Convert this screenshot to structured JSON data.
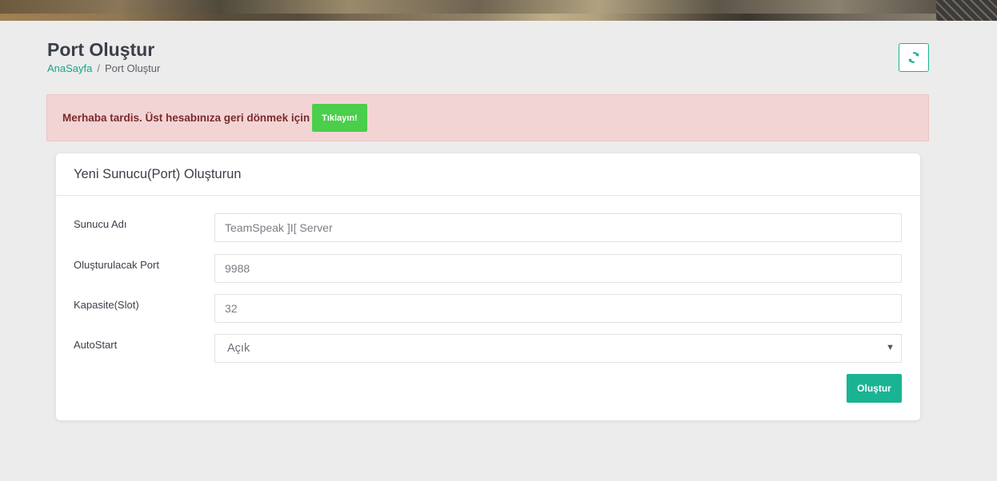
{
  "page": {
    "title": "Port Oluştur",
    "breadcrumb": {
      "home": "AnaSayfa",
      "separator": "/",
      "current": "Port Oluştur"
    }
  },
  "refresh": {
    "icon": "refresh-icon"
  },
  "alert": {
    "message": "Merhaba tardis. Üst hesabınıza geri dönmek için",
    "button_label": "Tıklayın!"
  },
  "form": {
    "title": "Yeni Sunucu(Port) Oluşturun",
    "fields": {
      "server_name": {
        "label": "Sunucu Adı",
        "placeholder": "TeamSpeak ]I[ Server"
      },
      "port": {
        "label": "Oluşturulacak Port",
        "placeholder": "9988"
      },
      "capacity": {
        "label": "Kapasite(Slot)",
        "value": "32"
      },
      "autostart": {
        "label": "AutoStart",
        "selected": "Açık"
      }
    },
    "submit_label": "Oluştur"
  },
  "colors": {
    "accent": "#1ab394",
    "alert_bg": "#f3d4d4",
    "alert_button": "#4bce4b",
    "page_bg": "#ececec"
  }
}
